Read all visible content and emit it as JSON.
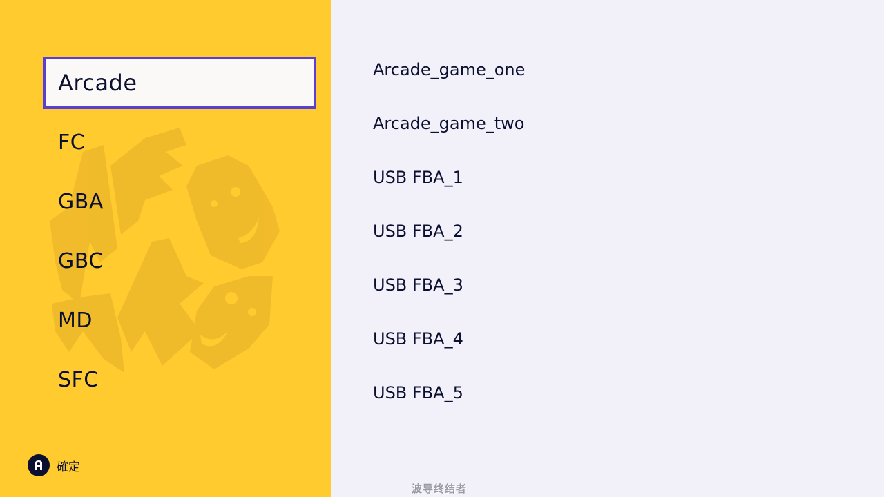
{
  "sidebar": {
    "systems": [
      {
        "label": "Arcade"
      },
      {
        "label": "FC"
      },
      {
        "label": "GBA"
      },
      {
        "label": "GBC"
      },
      {
        "label": "MD"
      },
      {
        "label": "SFC"
      }
    ],
    "selected_system": "Arcade",
    "background_art_icon": "retro-game-characters-art"
  },
  "footer": {
    "hint_icon": "a-button-icon",
    "hint_label": "確定"
  },
  "games": {
    "items": [
      {
        "label": "Arcade_game_one"
      },
      {
        "label": "Arcade_game_two"
      },
      {
        "label": "USB FBA_1"
      },
      {
        "label": "USB FBA_2"
      },
      {
        "label": "USB FBA_3"
      },
      {
        "label": "USB FBA_4"
      },
      {
        "label": "USB FBA_5"
      }
    ]
  },
  "watermark": "波导终结者",
  "colors": {
    "sidebar_bg": "#ffcb2f",
    "content_bg": "#f2f1fa",
    "selection_border": "#5a3fd6",
    "selection_fill": "#faf9f7",
    "text": "#0c1030"
  }
}
